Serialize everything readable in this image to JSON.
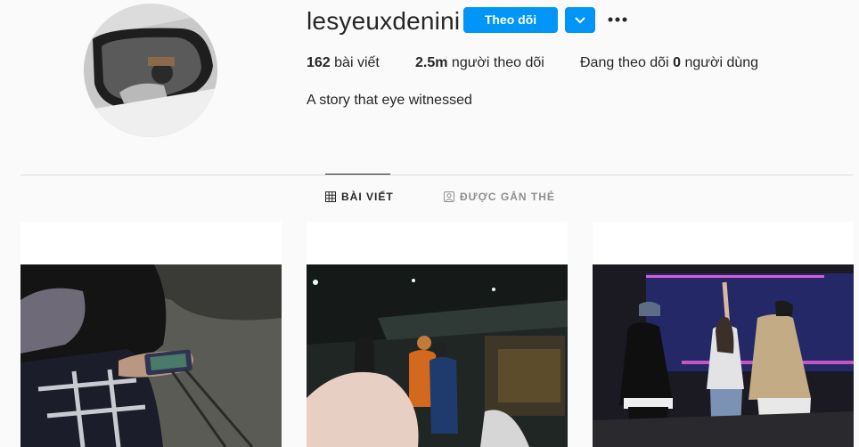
{
  "profile": {
    "username": "lesyeuxdenini",
    "follow_label": "Theo dõi",
    "bio": "A story that eye witnessed"
  },
  "stats": {
    "posts_count": "162",
    "posts_label": "bài viết",
    "followers_count": "2.5m",
    "followers_label": "người theo dõi",
    "following_prefix": "Đang theo dõi",
    "following_count": "0",
    "following_label": "người dùng"
  },
  "tabs": [
    {
      "label": "BÀI VIẾT",
      "icon": "grid-icon",
      "active": true
    },
    {
      "label": "ĐƯỢC GẮN THẺ",
      "icon": "tag-person-icon",
      "active": false
    }
  ],
  "colors": {
    "accent": "#0095f6",
    "background": "#fafafa",
    "text": "#262626",
    "muted": "#8e8e8e"
  },
  "posts": [
    {
      "name": "photo-hand-with-phone"
    },
    {
      "name": "photo-backstage-crowd"
    },
    {
      "name": "photo-stage-group-peace-sign"
    }
  ]
}
